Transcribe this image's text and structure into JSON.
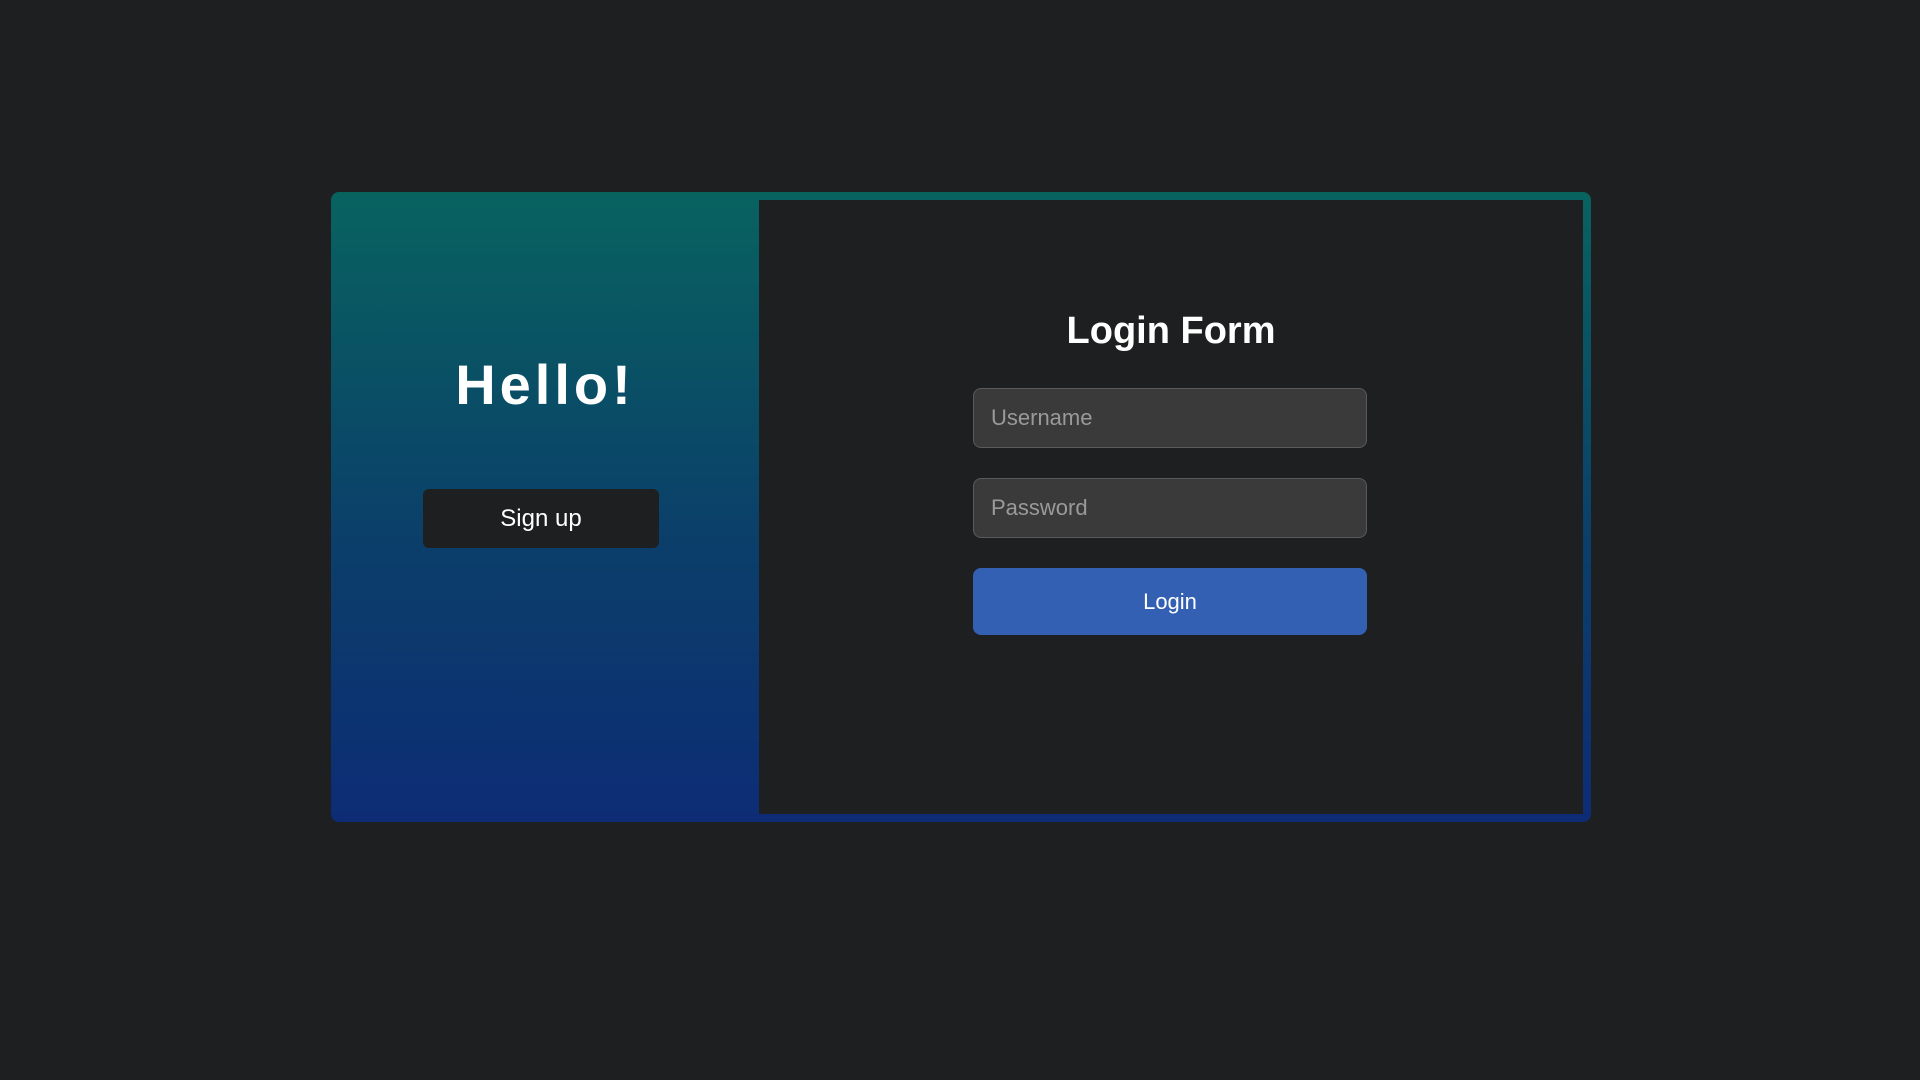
{
  "left_panel": {
    "greeting": "Hello!",
    "signup_label": "Sign up"
  },
  "login_form": {
    "title": "Login Form",
    "username_placeholder": "Username",
    "username_value": "",
    "password_placeholder": "Password",
    "password_value": "",
    "login_label": "Login"
  },
  "colors": {
    "page_background": "#1e1f21",
    "gradient_top": "#08635f",
    "gradient_bottom": "#0d2c75",
    "login_button": "#3460b4",
    "input_background": "#3a3a3a"
  }
}
